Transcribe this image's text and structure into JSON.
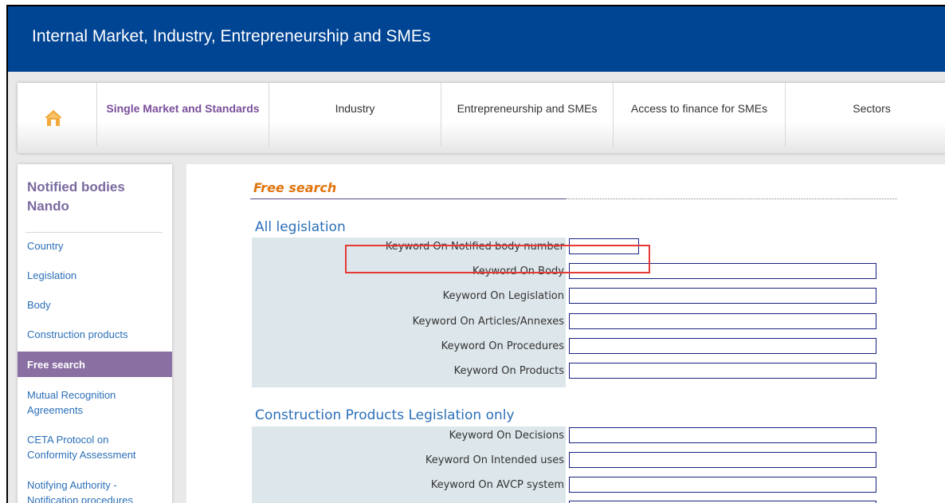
{
  "banner": {
    "title": "Internal Market, Industry, Entrepreneurship and SMEs"
  },
  "nav": {
    "home_icon": "home-icon",
    "items": [
      {
        "label": "Single Market and Standards",
        "active": true
      },
      {
        "label": "Industry"
      },
      {
        "label": "Entrepreneurship and SMEs"
      },
      {
        "label": "Access to finance for SMEs"
      },
      {
        "label": "Sectors"
      }
    ]
  },
  "sidebar": {
    "title": "Notified bodies Nando",
    "items": [
      {
        "label": "Country"
      },
      {
        "label": "Legislation"
      },
      {
        "label": "Body"
      },
      {
        "label": "Construction products"
      },
      {
        "label": "Free search",
        "active": true
      },
      {
        "label": "Mutual Recognition Agreements"
      },
      {
        "label": "CETA Protocol on Conformity Assessment"
      },
      {
        "label": "Notifying Authority - Notification procedures"
      }
    ]
  },
  "content": {
    "title": "Free search",
    "sections": [
      {
        "heading": "All legislation",
        "fields": [
          {
            "label": "Keyword On Notified body number",
            "value": ""
          },
          {
            "label": "Keyword On Body",
            "value": ""
          },
          {
            "label": "Keyword On Legislation",
            "value": ""
          },
          {
            "label": "Keyword On Articles/Annexes",
            "value": ""
          },
          {
            "label": "Keyword On Procedures",
            "value": ""
          },
          {
            "label": "Keyword On Products",
            "value": ""
          }
        ]
      },
      {
        "heading": "Construction Products Legislation only",
        "fields": [
          {
            "label": "Keyword On Decisions",
            "value": ""
          },
          {
            "label": "Keyword On Intended uses",
            "value": ""
          },
          {
            "label": "Keyword On AVCP system",
            "value": ""
          }
        ]
      }
    ]
  },
  "colors": {
    "banner": "#004494",
    "accent_purple": "#8a6fa3",
    "link_blue": "#2b6fb8",
    "title_orange": "#e0750f",
    "highlight_red": "#e53935"
  }
}
